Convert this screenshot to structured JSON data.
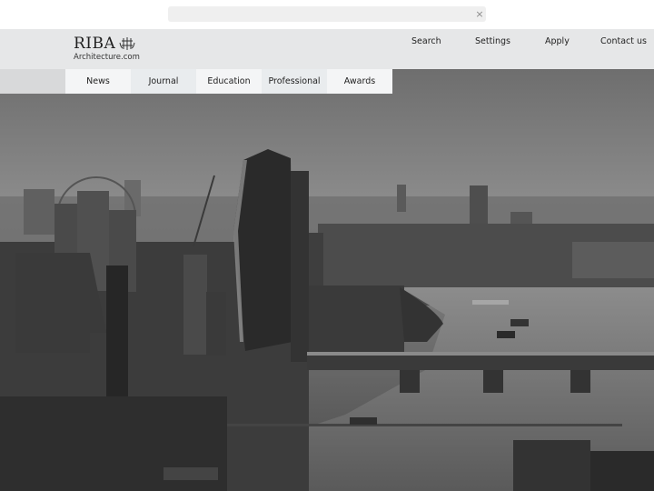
{
  "browser": {
    "search_value": "",
    "close_icon": "×"
  },
  "header": {
    "logo_text": "RIBA",
    "logo_subtext": "Architecture.com",
    "utility_nav": [
      {
        "label": "Search"
      },
      {
        "label": "Settings"
      },
      {
        "label": "Apply"
      },
      {
        "label": "Contact us"
      }
    ]
  },
  "main_nav": [
    {
      "label": "News"
    },
    {
      "label": "Journal"
    },
    {
      "label": "Education"
    },
    {
      "label": "Professional"
    },
    {
      "label": "Awards"
    }
  ],
  "hero": {
    "description": "Black and white aerial view of London skyline with the River Thames, bridges and the London Eye"
  }
}
